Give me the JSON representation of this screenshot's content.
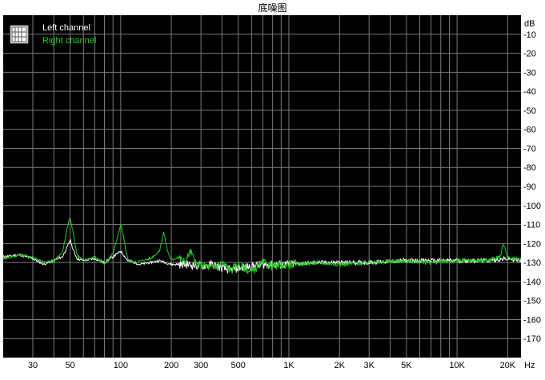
{
  "chart_data": {
    "type": "line",
    "title": "底噪图",
    "ylabel": "dB",
    "xlabel": "Hz",
    "x_scale": "log",
    "xlim": [
      20,
      24000
    ],
    "ylim": [
      -180,
      0
    ],
    "y_ticks": [
      -10,
      -20,
      -30,
      -40,
      -50,
      -60,
      -70,
      -80,
      -90,
      -100,
      -110,
      -120,
      -130,
      -140,
      -150,
      -160,
      -170
    ],
    "x_ticks": [
      {
        "value": 30,
        "label": "30"
      },
      {
        "value": 50,
        "label": "50"
      },
      {
        "value": 100,
        "label": "100"
      },
      {
        "value": 200,
        "label": "200"
      },
      {
        "value": 300,
        "label": "300"
      },
      {
        "value": 500,
        "label": "500"
      },
      {
        "value": 1000,
        "label": "1K"
      },
      {
        "value": 2000,
        "label": "2K"
      },
      {
        "value": 3000,
        "label": "3K"
      },
      {
        "value": 5000,
        "label": "5K"
      },
      {
        "value": 10000,
        "label": "10K"
      },
      {
        "value": 20000,
        "label": "20K"
      }
    ],
    "grid": true,
    "legend_position": "top-left",
    "background": "#000000",
    "series": [
      {
        "name": "Left channel",
        "color": "#ffffff",
        "points": [
          [
            20,
            -127
          ],
          [
            25,
            -126
          ],
          [
            30,
            -128
          ],
          [
            35,
            -131
          ],
          [
            40,
            -129
          ],
          [
            45,
            -127
          ],
          [
            48,
            -122
          ],
          [
            50,
            -118
          ],
          [
            52,
            -123
          ],
          [
            55,
            -128
          ],
          [
            60,
            -129
          ],
          [
            70,
            -128
          ],
          [
            80,
            -130
          ],
          [
            90,
            -127
          ],
          [
            100,
            -124
          ],
          [
            110,
            -129
          ],
          [
            120,
            -130
          ],
          [
            130,
            -131
          ],
          [
            150,
            -130
          ],
          [
            170,
            -129
          ],
          [
            200,
            -131
          ],
          [
            250,
            -131
          ],
          [
            300,
            -132
          ],
          [
            350,
            -131
          ],
          [
            400,
            -133
          ],
          [
            450,
            -134
          ],
          [
            500,
            -133
          ],
          [
            600,
            -132
          ],
          [
            700,
            -131
          ],
          [
            800,
            -131
          ],
          [
            1000,
            -131
          ],
          [
            1500,
            -130
          ],
          [
            2000,
            -130
          ],
          [
            3000,
            -130
          ],
          [
            5000,
            -129
          ],
          [
            7000,
            -129
          ],
          [
            10000,
            -129
          ],
          [
            15000,
            -129
          ],
          [
            20000,
            -128
          ],
          [
            24000,
            -129
          ]
        ]
      },
      {
        "name": "Right channel",
        "color": "#22cc22",
        "points": [
          [
            20,
            -128
          ],
          [
            25,
            -126
          ],
          [
            30,
            -127
          ],
          [
            35,
            -130
          ],
          [
            40,
            -129
          ],
          [
            45,
            -125
          ],
          [
            48,
            -112
          ],
          [
            50,
            -106
          ],
          [
            52,
            -114
          ],
          [
            55,
            -126
          ],
          [
            60,
            -129
          ],
          [
            70,
            -127
          ],
          [
            80,
            -131
          ],
          [
            90,
            -125
          ],
          [
            95,
            -118
          ],
          [
            100,
            -110
          ],
          [
            105,
            -119
          ],
          [
            110,
            -128
          ],
          [
            120,
            -130
          ],
          [
            150,
            -128
          ],
          [
            170,
            -124
          ],
          [
            180,
            -114
          ],
          [
            190,
            -124
          ],
          [
            200,
            -129
          ],
          [
            220,
            -127
          ],
          [
            240,
            -130
          ],
          [
            260,
            -124
          ],
          [
            280,
            -131
          ],
          [
            300,
            -131
          ],
          [
            350,
            -133
          ],
          [
            400,
            -130
          ],
          [
            450,
            -134
          ],
          [
            500,
            -131
          ],
          [
            600,
            -135
          ],
          [
            700,
            -130
          ],
          [
            800,
            -132
          ],
          [
            1000,
            -131
          ],
          [
            1500,
            -130
          ],
          [
            2000,
            -131
          ],
          [
            3000,
            -130
          ],
          [
            5000,
            -129
          ],
          [
            7000,
            -130
          ],
          [
            10000,
            -129
          ],
          [
            15000,
            -129
          ],
          [
            18000,
            -127
          ],
          [
            19000,
            -120
          ],
          [
            20000,
            -128
          ],
          [
            24000,
            -128
          ]
        ]
      }
    ]
  }
}
